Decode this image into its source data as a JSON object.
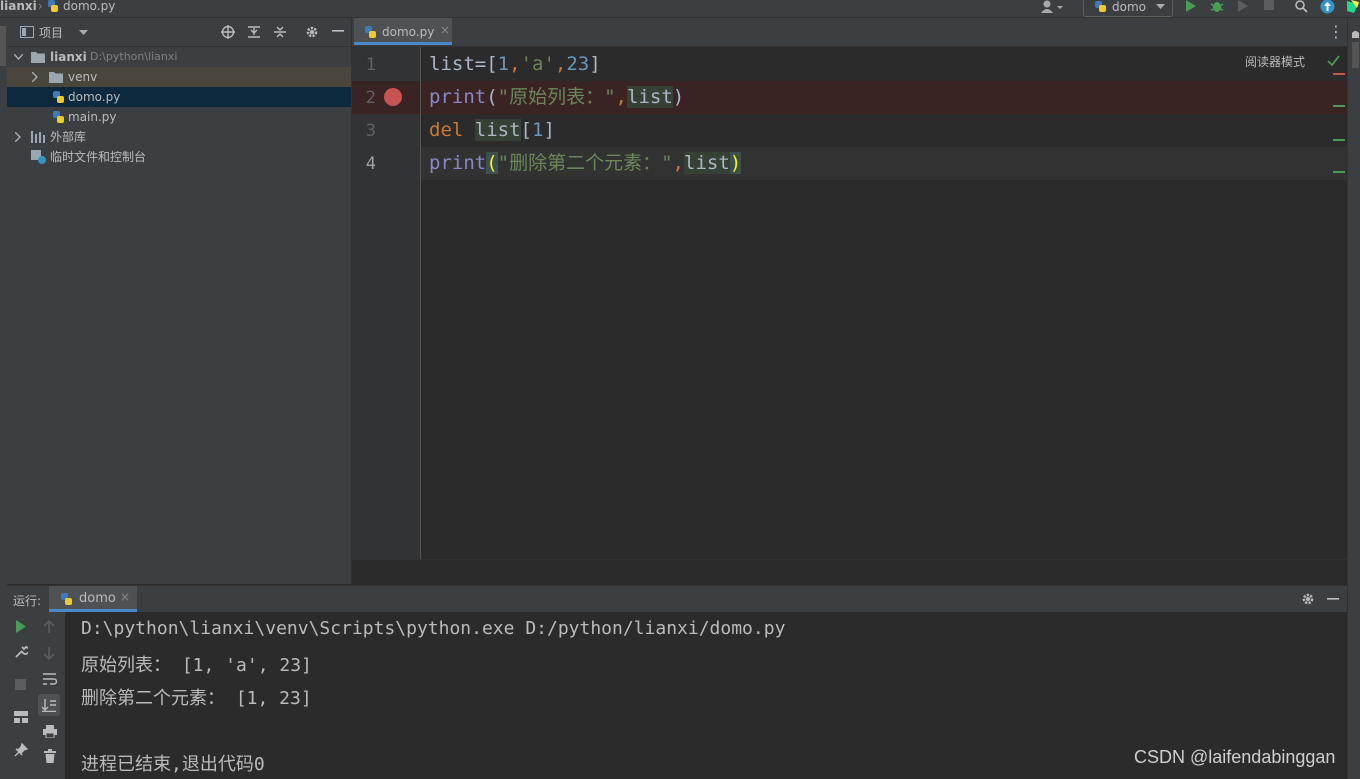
{
  "navbar": {
    "project_crumb": "lianxi",
    "file_crumb": "domo.py",
    "run_config": "domo"
  },
  "project_panel": {
    "title": "项目",
    "root": {
      "name": "lianxi",
      "path": "D:\\python\\lianxi"
    },
    "items": [
      {
        "label": "venv"
      },
      {
        "label": "domo.py"
      },
      {
        "label": "main.py"
      },
      {
        "label": "外部库"
      },
      {
        "label": "临时文件和控制台"
      }
    ]
  },
  "editor": {
    "tab_label": "domo.py",
    "reader_mode": "阅读器模式",
    "line_numbers": [
      "1",
      "2",
      "3",
      "4"
    ],
    "lines": {
      "l1": {
        "a": "list",
        "b": "=[",
        "c": "1",
        "d": ",",
        "e": "'a'",
        "f": ",",
        "g": "23",
        "h": "]"
      },
      "l2": {
        "a": "print",
        "b": "(",
        "c": "\"原始列表：\"",
        "d": ",",
        "e": "list",
        "f": ")"
      },
      "l3": {
        "a": "del",
        "b": " ",
        "c": "list",
        "d": "[",
        "e": "1",
        "f": "]"
      },
      "l4": {
        "a": "print",
        "b": "(",
        "c": "\"删除第二个元素：\"",
        "d": ",",
        "e": "list",
        "f": ")"
      }
    }
  },
  "run_panel": {
    "label": "运行:",
    "tab_label": "domo",
    "console": [
      "D:\\python\\lianxi\\venv\\Scripts\\python.exe D:/python/lianxi/domo.py",
      "原始列表： [1, 'a', 23]",
      "删除第二个元素： [1, 23]",
      "",
      "进程已结束,退出代码0"
    ]
  },
  "watermark": "CSDN @laifendabinggan",
  "colors": {
    "breakpoint": "#c75450",
    "accent": "#4a88c7",
    "run_green": "#499c54"
  }
}
